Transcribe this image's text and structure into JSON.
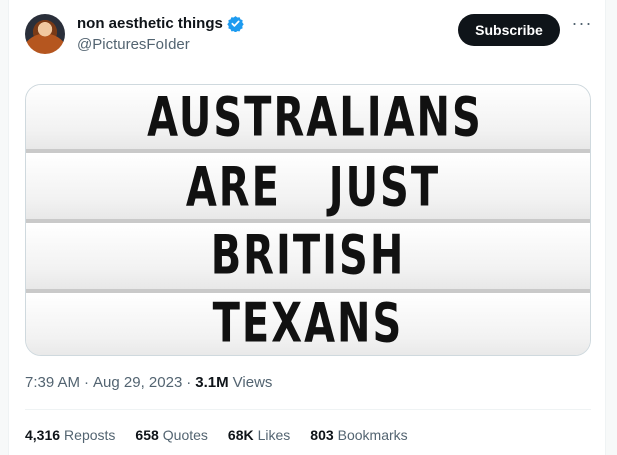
{
  "author": {
    "display_name": "non aesthetic things",
    "handle": "@PicturesFoIder",
    "verified": true,
    "subscribe_label": "Subscribe",
    "more_icon": "more-horizontal-icon"
  },
  "media": {
    "sign_lines": [
      "AUSTRALIANS",
      "ARE   JUST",
      "BRITISH",
      "TEXANS"
    ]
  },
  "meta": {
    "time": "7:39 AM",
    "separator1": "·",
    "date": "Aug 29, 2023",
    "separator2": "·",
    "views_count": "3.1M",
    "views_label": "Views"
  },
  "stats": {
    "reposts_count": "4,316",
    "reposts_label": "Reposts",
    "quotes_count": "658",
    "quotes_label": "Quotes",
    "likes_count": "68K",
    "likes_label": "Likes",
    "bookmarks_count": "803",
    "bookmarks_label": "Bookmarks"
  },
  "colors": {
    "text_primary": "#0f1419",
    "text_secondary": "#536471",
    "verified_blue": "#1d9bf0",
    "button_bg": "#0f1419"
  }
}
